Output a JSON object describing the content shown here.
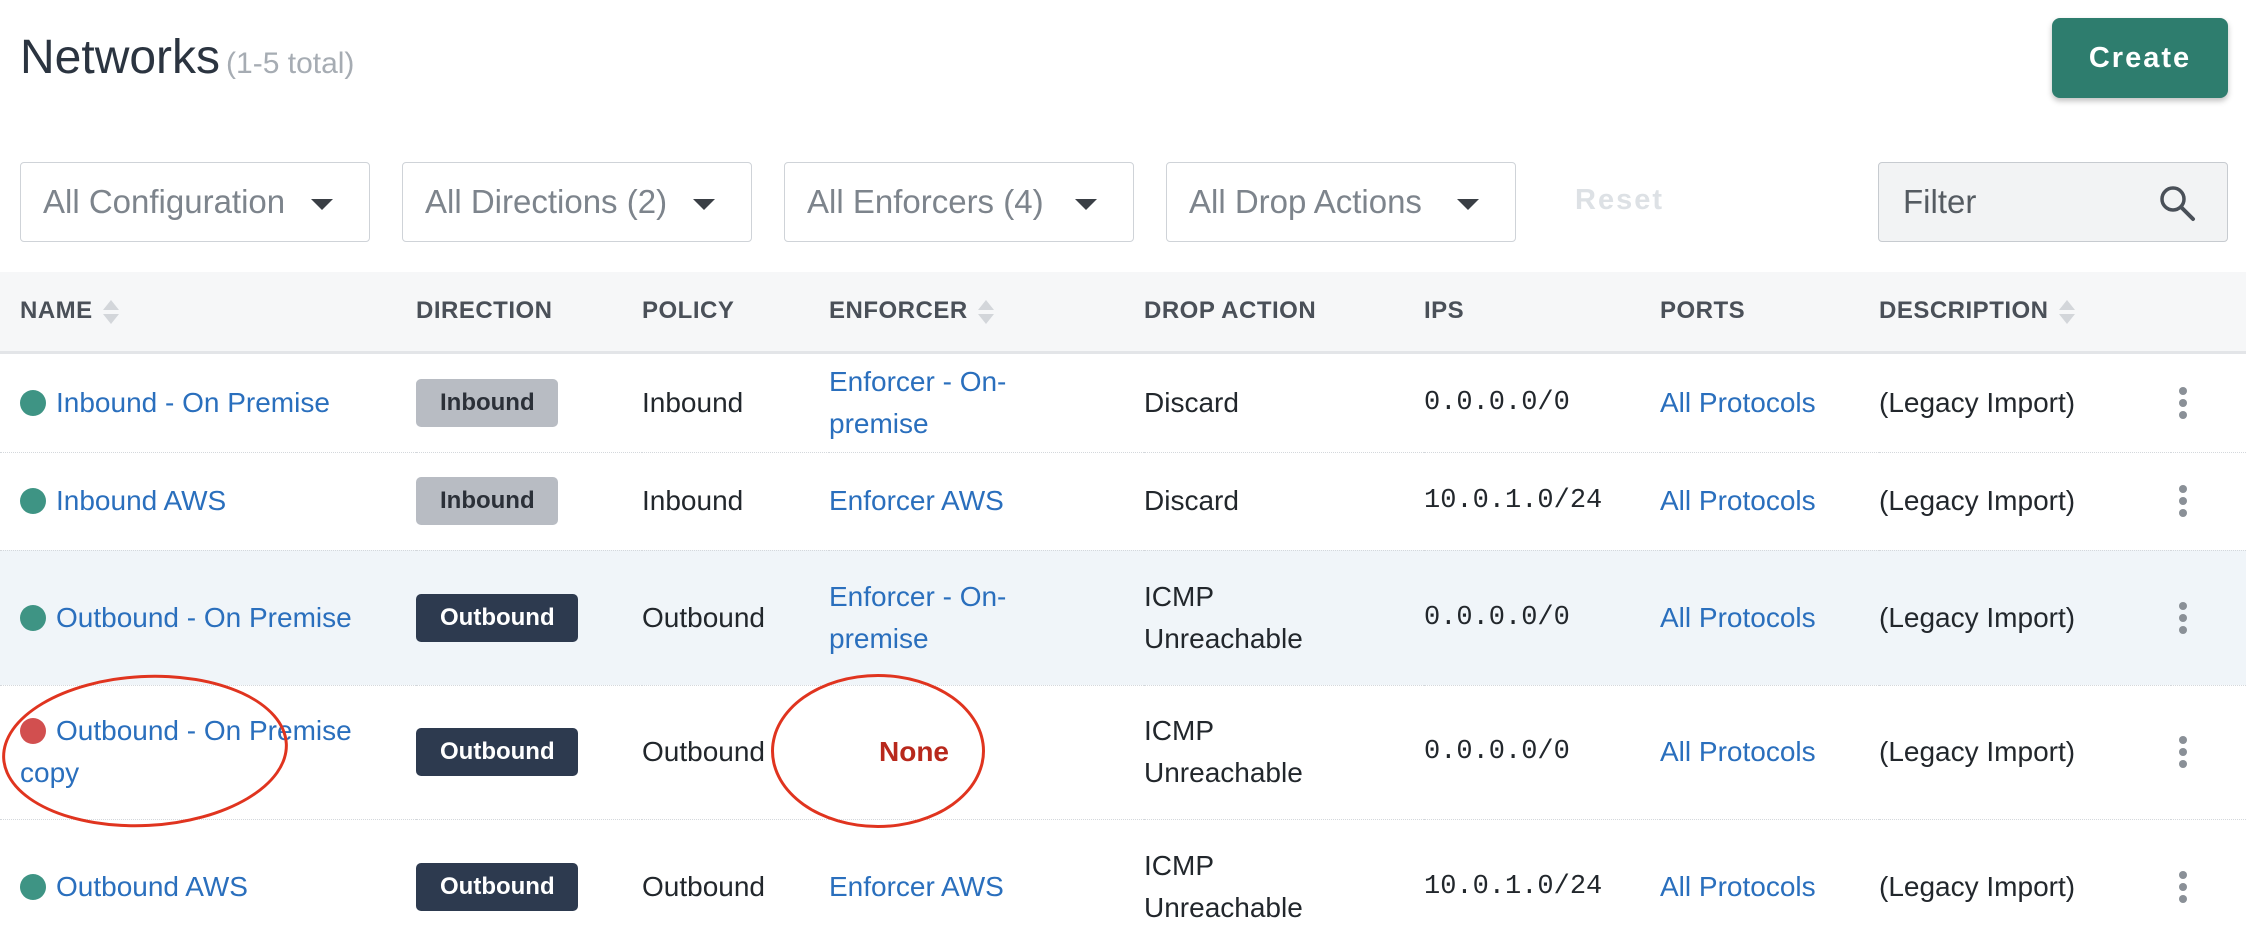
{
  "header": {
    "title": "Networks",
    "count": "(1-5 total)",
    "create_label": "Create"
  },
  "filters": {
    "configuration": "All Configuration",
    "directions": "All Directions (2)",
    "enforcers": "All Enforcers (4)",
    "drop_actions": "All Drop Actions (",
    "reset_label": "Reset",
    "filter_placeholder": "Filter"
  },
  "table": {
    "columns": [
      "NAME",
      "DIRECTION",
      "POLICY",
      "ENFORCER",
      "DROP ACTION",
      "IPS",
      "PORTS",
      "DESCRIPTION"
    ],
    "rows": [
      {
        "status": "green",
        "name": "Inbound - On Premise",
        "direction": "Inbound",
        "policy": "Inbound",
        "enforcer": "Enforcer - On-premise",
        "drop_action": "Discard",
        "ips": "0.0.0.0/0",
        "ports": "All Protocols",
        "description": "(Legacy Import)"
      },
      {
        "status": "green",
        "name": "Inbound AWS",
        "direction": "Inbound",
        "policy": "Inbound",
        "enforcer": "Enforcer AWS",
        "drop_action": "Discard",
        "ips": "10.0.1.0/24",
        "ports": "All Protocols",
        "description": "(Legacy Import)"
      },
      {
        "status": "green",
        "name": "Outbound - On Premise",
        "direction": "Outbound",
        "policy": "Outbound",
        "enforcer": "Enforcer - On-premise",
        "drop_action": "ICMP Unreachable",
        "ips": "0.0.0.0/0",
        "ports": "All Protocols",
        "description": "(Legacy Import)"
      },
      {
        "status": "red",
        "name": "Outbound - On Premise copy",
        "direction": "Outbound",
        "policy": "Outbound",
        "enforcer": "None",
        "drop_action": "ICMP Unreachable",
        "ips": "0.0.0.0/0",
        "ports": "All Protocols",
        "description": "(Legacy Import)"
      },
      {
        "status": "green",
        "name": "Outbound AWS",
        "direction": "Outbound",
        "policy": "Outbound",
        "enforcer": "Enforcer AWS",
        "drop_action": "ICMP Unreachable",
        "ips": "10.0.1.0/24",
        "ports": "All Protocols",
        "description": "(Legacy Import)"
      }
    ]
  },
  "colors": {
    "accent": "#2e7d6e",
    "link": "#2a6fbd",
    "status_ok": "#3e9484",
    "status_error": "#d24f4f",
    "annotation": "#e0341f"
  }
}
